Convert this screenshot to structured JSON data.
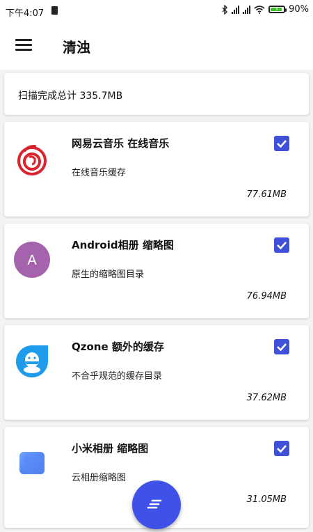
{
  "status_bar": {
    "time": "下午4:07",
    "battery_percent": "90%",
    "battery_level": 0.9,
    "icons": [
      "sd-card-icon",
      "bluetooth-icon",
      "signal-icon",
      "signal-icon",
      "wifi-icon",
      "battery-icon"
    ]
  },
  "app_bar": {
    "title": "清浊",
    "menu_icon": "hamburger-menu-icon"
  },
  "summary": {
    "text": "扫描完成总计 335.7MB"
  },
  "items": [
    {
      "title": "网易云音乐 在线音乐",
      "description": "在线音乐缓存",
      "size": "77.61MB",
      "checked": true,
      "icon": "netease-music-icon"
    },
    {
      "title": "Android相册 缩略图",
      "description": "原生的缩略图目录",
      "size": "76.94MB",
      "checked": true,
      "icon": "avatar-letter-icon",
      "icon_letter": "A"
    },
    {
      "title": "Qzone 额外的缓存",
      "description": "不合乎规范的缓存目录",
      "size": "37.62MB",
      "checked": true,
      "icon": "qq-penguin-icon"
    },
    {
      "title": "小米相册 缩略图",
      "description": "云相册缩略图",
      "size": "31.05MB",
      "checked": true,
      "icon": "mi-gallery-icon"
    }
  ],
  "fab": {
    "icon": "sort-lines-icon"
  },
  "colors": {
    "accent": "#3f51e8",
    "checkbox": "#3f51d9",
    "netease_red": "#d9232d",
    "avatar_purple": "#a563ad",
    "qq_blue": "#1e9bea",
    "mi_gallery_blue": "#4a7ef0",
    "battery_green": "#3dbb2a"
  }
}
